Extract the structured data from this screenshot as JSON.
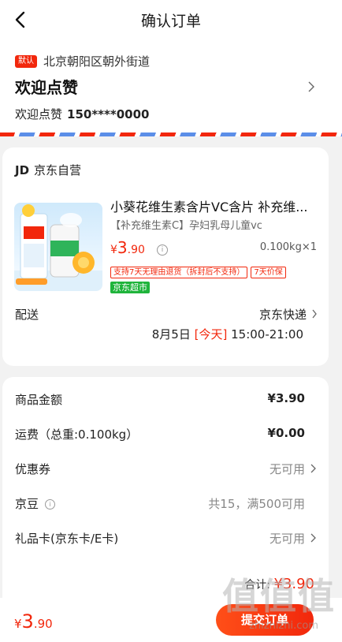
{
  "header": {
    "title": "确认订单"
  },
  "address": {
    "badge": "默认",
    "region": "北京朝阳区朝外街道",
    "name": "欢迎点赞",
    "contact_name": "欢迎点赞",
    "phone": "150****0000"
  },
  "shop": {
    "logo": "JD",
    "name": "京东自营"
  },
  "product": {
    "title": "小葵花维生素含片VC含片 补充维...",
    "spec": "【补充维生素C】孕妇乳母儿童vc",
    "price_symbol": "¥",
    "price_int": "3",
    "price_dec": ".90",
    "quantity": "0.100kg×1",
    "tags": [
      "支持7天无理由退货（拆封后不支持）",
      "7天价保"
    ],
    "store_tag": "京东超市"
  },
  "delivery": {
    "label": "配送",
    "method": "京东快递",
    "date": "8月5日",
    "today": "[今天]",
    "time": "15:00-21:00"
  },
  "summary": {
    "rows": [
      {
        "label": "商品金额",
        "value": "¥3.90"
      },
      {
        "label": "运费（总重:0.100kg）",
        "value": "¥0.00"
      },
      {
        "label": "优惠券",
        "value": "无可用"
      },
      {
        "label": "京豆",
        "value": "共15，满500可用"
      },
      {
        "label": "礼品卡(京东卡/E卡)",
        "value": "无可用"
      }
    ],
    "total_label": "合计:",
    "total_price": "¥3.90"
  },
  "bottom": {
    "price_symbol": "¥",
    "price_int": "3",
    "price_dec": ".90",
    "submit_label": "提交订单"
  },
  "watermark": {
    "text": "值值值",
    "url": "zhizhizhi.com"
  },
  "colors": {
    "accent": "#f2270c",
    "green_tag": "#1fb43b",
    "stripe_blue": "#5b8ee8"
  }
}
